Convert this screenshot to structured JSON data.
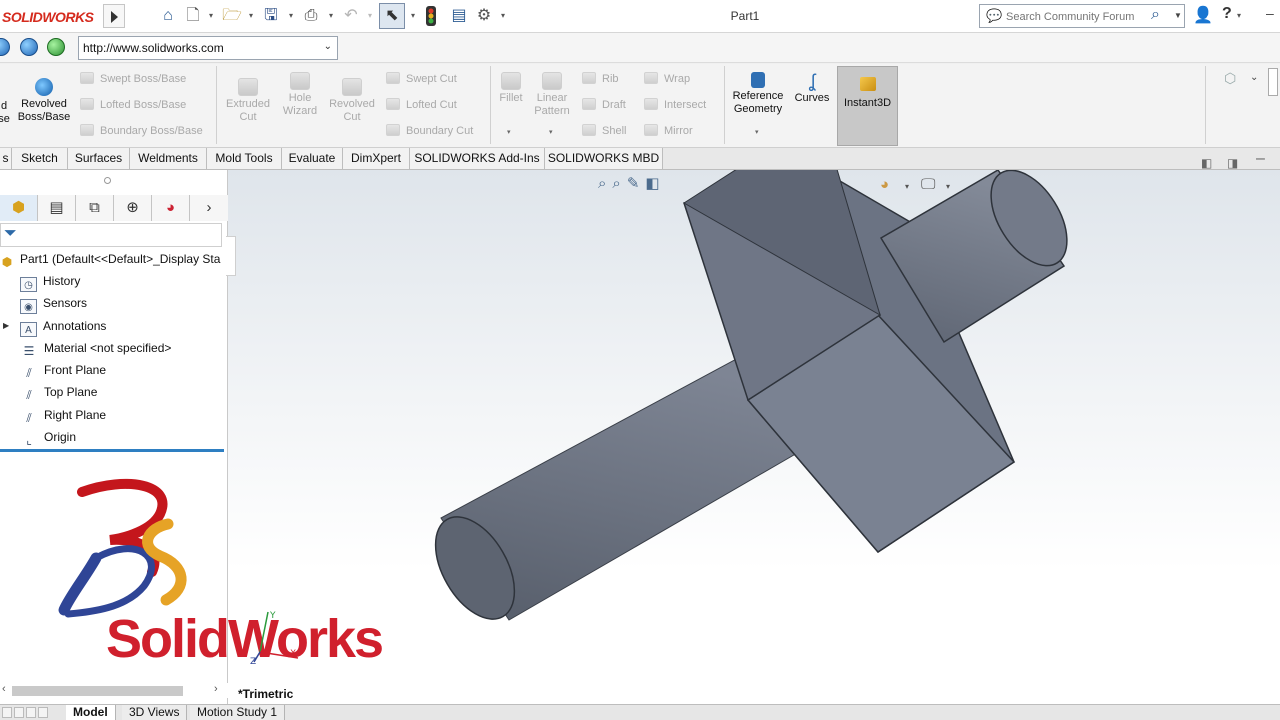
{
  "titlebar": {
    "brand": "SOLIDWORKS",
    "document_title": "Part1",
    "search_placeholder": "Search Community Forum"
  },
  "address": {
    "url": "http://www.solidworks.com"
  },
  "commands": {
    "left_partial_1": "d",
    "left_partial_2": "se",
    "revolved_boss": "Revolved\nBoss/Base",
    "swept_boss": "Swept Boss/Base",
    "lofted_boss": "Lofted Boss/Base",
    "boundary_boss": "Boundary Boss/Base",
    "extruded_cut": "Extruded\nCut",
    "hole_wizard": "Hole\nWizard",
    "revolved_cut": "Revolved\nCut",
    "swept_cut": "Swept Cut",
    "lofted_cut": "Lofted Cut",
    "boundary_cut": "Boundary Cut",
    "fillet": "Fillet",
    "linear_pattern": "Linear\nPattern",
    "rib": "Rib",
    "draft": "Draft",
    "shell": "Shell",
    "wrap": "Wrap",
    "intersect": "Intersect",
    "mirror": "Mirror",
    "reference_geometry": "Reference\nGeometry",
    "curves": "Curves",
    "instant3d": "Instant3D"
  },
  "tabs": [
    {
      "label": "s"
    },
    {
      "label": "Sketch"
    },
    {
      "label": "Surfaces"
    },
    {
      "label": "Weldments"
    },
    {
      "label": "Mold Tools"
    },
    {
      "label": "Evaluate"
    },
    {
      "label": "DimXpert"
    },
    {
      "label": "SOLIDWORKS Add-Ins"
    },
    {
      "label": "SOLIDWORKS MBD"
    }
  ],
  "tree": {
    "root": "Part1  (Default<<Default>_Display Sta",
    "items": [
      {
        "label": "History"
      },
      {
        "label": "Sensors"
      },
      {
        "label": "Annotations"
      },
      {
        "label": "Material <not specified>"
      },
      {
        "label": "Front Plane"
      },
      {
        "label": "Top Plane"
      },
      {
        "label": "Right Plane"
      },
      {
        "label": "Origin"
      }
    ]
  },
  "viewport": {
    "view_label": "*Trimetric"
  },
  "logo": {
    "text": "SolidWorks"
  },
  "bottom_tabs": [
    {
      "label": "Model"
    },
    {
      "label": "3D Views"
    },
    {
      "label": "Motion Study 1"
    }
  ],
  "icons": {
    "home": "home-icon",
    "new": "new-file-icon",
    "open": "open-folder-icon",
    "save": "save-icon",
    "print": "print-icon",
    "undo": "undo-icon",
    "select": "select-cursor-icon",
    "rebuild": "rebuild-traffic-light-icon",
    "file_props": "file-properties-icon",
    "options": "gear-icon"
  },
  "colors": {
    "brand_red": "#d52b1e",
    "logo_red": "#d0202d",
    "model_grey": "#6d7584",
    "accent_blue": "#2e7fc2"
  }
}
